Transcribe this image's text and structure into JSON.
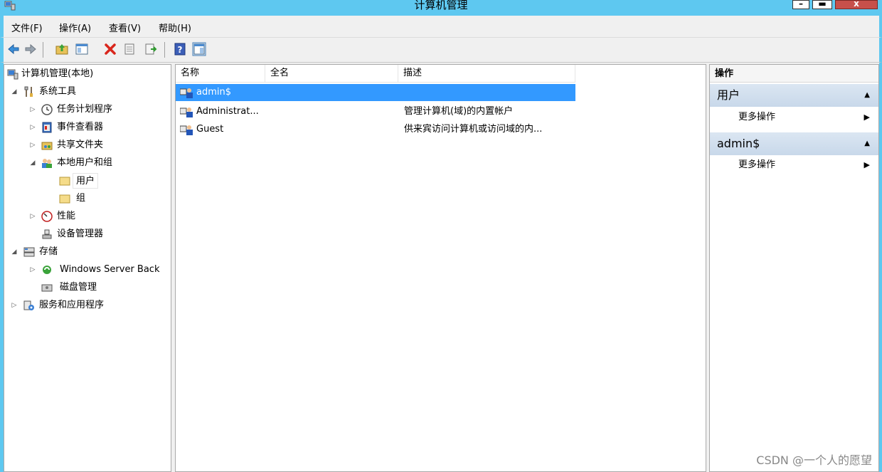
{
  "window": {
    "title": "计算机管理",
    "min": "–",
    "max": "▬",
    "close": "x"
  },
  "menu": [
    "文件(F)",
    "操作(A)",
    "查看(V)",
    "帮助(H)"
  ],
  "tree": {
    "root": "计算机管理(本地)",
    "system_tools": "系统工具",
    "task_scheduler": "任务计划程序",
    "event_viewer": "事件查看器",
    "shared_folders": "共享文件夹",
    "local_users_groups": "本地用户和组",
    "users": "用户",
    "groups": "组",
    "performance": "性能",
    "device_manager": "设备管理器",
    "storage": "存储",
    "windows_server_backup": "Windows Server Back",
    "disk_management": "磁盘管理",
    "services_apps": "服务和应用程序"
  },
  "list": {
    "columns": [
      "名称",
      "全名",
      "描述"
    ],
    "rows": [
      {
        "name": "admin$",
        "fullname": "",
        "description": ""
      },
      {
        "name": "Administrat...",
        "fullname": "",
        "description": "管理计算机(域)的内置帐户"
      },
      {
        "name": "Guest",
        "fullname": "",
        "description": "供来宾访问计算机或访问域的内..."
      }
    ]
  },
  "actions": {
    "header": "操作",
    "section1": "用户",
    "section1_more": "更多操作",
    "section2": "admin$",
    "section2_more": "更多操作"
  },
  "watermark": "CSDN @一个人的愿望",
  "colors": {
    "titlebar": "#5ec8f0",
    "selection": "#3399ff",
    "close": "#c7504b"
  }
}
